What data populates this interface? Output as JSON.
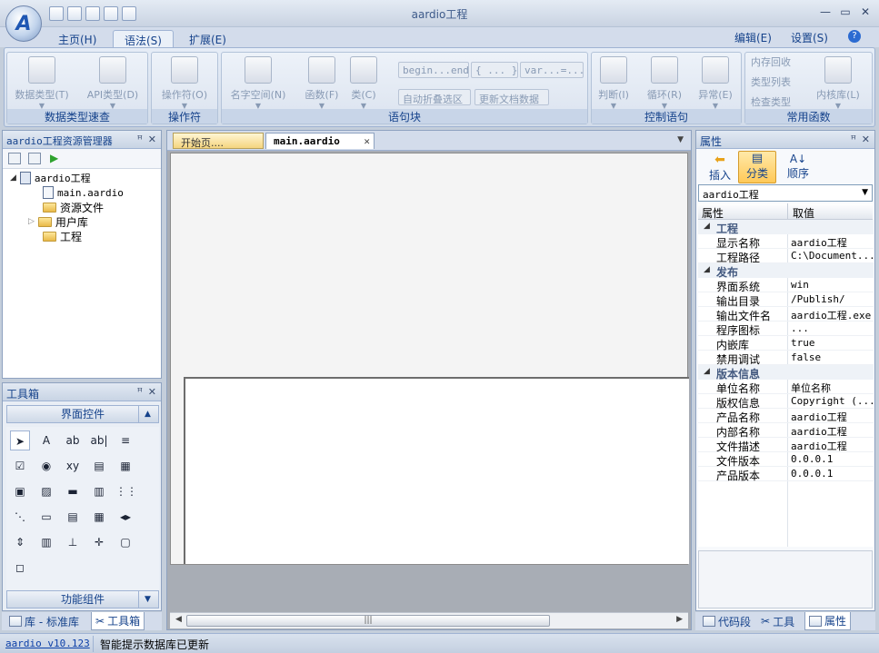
{
  "window": {
    "title": "aardio工程",
    "min_label": "—",
    "max_label": "▭",
    "close_label": "✕"
  },
  "ribbon_tabs": [
    {
      "label": "主页(H)"
    },
    {
      "label": "语法(S)"
    },
    {
      "label": "扩展(E)"
    }
  ],
  "ribbon_right": {
    "edit_label": "编辑(E)",
    "settings_label": "设置(S)",
    "help_label": "?"
  },
  "ribbon_groups": {
    "datatype": {
      "caption": "数据类型速查",
      "btn1": "数据类型(T)",
      "btn2": "API类型(D)"
    },
    "operator": {
      "caption": "操作符",
      "btn1": "操作符(O)"
    },
    "block": {
      "caption": "语句块",
      "btn1": "名字空间(N)",
      "btn2": "函数(F)",
      "btn3": "类(C)",
      "snip1": "begin...end",
      "snip2": "{ ... }",
      "snip3": "var...=...",
      "fold_label": "自动折叠选区",
      "update_label": "更新文档数据"
    },
    "control": {
      "caption": "控制语句",
      "btn1": "判断(I)",
      "btn2": "循环(R)",
      "btn3": "异常(E)"
    },
    "common": {
      "caption": "常用函数",
      "item1": "内存回收",
      "item2": "类型列表",
      "item3": "检查类型",
      "btn1": "内核库(L)"
    }
  },
  "explorer": {
    "title": "aardio工程资源管理器",
    "tree": [
      {
        "label": "aardio工程"
      },
      {
        "label": "main.aardio"
      },
      {
        "label": "资源文件"
      },
      {
        "label": "用户库"
      },
      {
        "label": "工程"
      }
    ]
  },
  "toolbox": {
    "title": "工具箱",
    "section1": "界面控件",
    "section2": "功能组件",
    "tools": [
      {
        "glyph": "➤"
      },
      {
        "glyph": "A"
      },
      {
        "glyph": "ab"
      },
      {
        "glyph": "ab|"
      },
      {
        "glyph": "≡"
      },
      {
        "glyph": "☑"
      },
      {
        "glyph": "◉"
      },
      {
        "glyph": "xy"
      },
      {
        "glyph": "▤"
      },
      {
        "glyph": "▦"
      },
      {
        "glyph": "▣"
      },
      {
        "glyph": "▨"
      },
      {
        "glyph": "▬"
      },
      {
        "glyph": "▥"
      },
      {
        "glyph": "⋮⋮"
      },
      {
        "glyph": "⋱"
      },
      {
        "glyph": "▭"
      },
      {
        "glyph": "▤"
      },
      {
        "glyph": "▦"
      },
      {
        "glyph": "◂▸"
      },
      {
        "glyph": "⇕"
      },
      {
        "glyph": "▥"
      },
      {
        "glyph": "⊥"
      },
      {
        "glyph": "✛"
      },
      {
        "glyph": "▢"
      },
      {
        "glyph": "◻"
      }
    ]
  },
  "bottom_tabs_left": [
    {
      "label": "库 - 标准库"
    },
    {
      "label": "工具箱"
    }
  ],
  "doc_tabs": [
    {
      "label": "开始页...."
    },
    {
      "label": "main.aardio"
    }
  ],
  "editor": {
    "scroll_grip": "|||"
  },
  "properties": {
    "title": "属性",
    "btn_insert": "插入",
    "btn_category": "分类",
    "btn_order": "顺序",
    "selector_value": "aardio工程",
    "col_name": "属性",
    "col_value": "取值",
    "cat_project": "工程",
    "cat_publish": "发布",
    "cat_version": "版本信息",
    "rows_project": [
      {
        "k": "显示名称",
        "v": "aardio工程"
      },
      {
        "k": "工程路径",
        "v": "C:\\Document..."
      }
    ],
    "rows_publish": [
      {
        "k": "界面系统",
        "v": "win"
      },
      {
        "k": "输出目录",
        "v": "/Publish/"
      },
      {
        "k": "输出文件名",
        "v": "aardio工程.exe"
      },
      {
        "k": "程序图标",
        "v": "..."
      },
      {
        "k": "内嵌库",
        "v": "true"
      },
      {
        "k": "禁用调试",
        "v": "false"
      }
    ],
    "rows_version": [
      {
        "k": "单位名称",
        "v": "单位名称"
      },
      {
        "k": "版权信息",
        "v": "Copyright (..."
      },
      {
        "k": "产品名称",
        "v": "aardio工程"
      },
      {
        "k": "内部名称",
        "v": "aardio工程"
      },
      {
        "k": "文件描述",
        "v": "aardio工程"
      },
      {
        "k": "文件版本",
        "v": "0.0.0.1"
      },
      {
        "k": "产品版本",
        "v": "0.0.0.1"
      }
    ]
  },
  "bottom_tabs_right": [
    {
      "label": "代码段"
    },
    {
      "label": "工具"
    },
    {
      "label": "属性"
    }
  ],
  "statusbar": {
    "version_link": "aardio v10.123",
    "message": "智能提示数据库已更新"
  }
}
